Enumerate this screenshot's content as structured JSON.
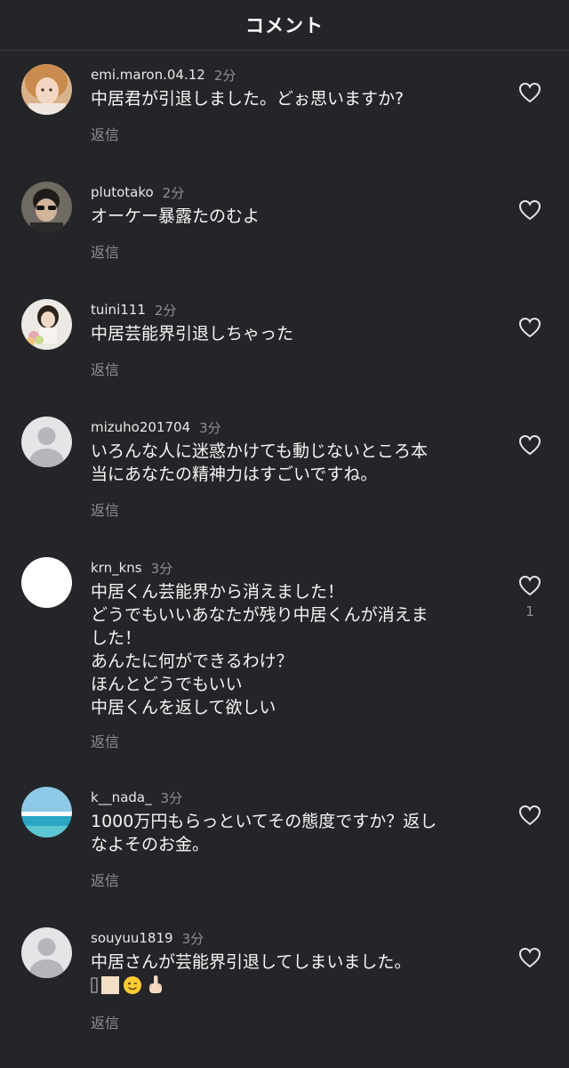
{
  "header": {
    "title": "コメント"
  },
  "comments": [
    {
      "username": "emi.maron.04.12",
      "time": "2分",
      "lines": [
        "中居君が引退しました。どぉ思いますか?"
      ],
      "reply_label": "返信"
    },
    {
      "username": "plutotako",
      "time": "2分",
      "lines": [
        "オーケー暴露たのむよ"
      ],
      "reply_label": "返信"
    },
    {
      "username": "tuini111",
      "time": "2分",
      "lines": [
        "中居芸能界引退しちゃった"
      ],
      "reply_label": "返信"
    },
    {
      "username": "mizuho201704",
      "time": "3分",
      "lines": [
        "いろんな人に迷惑かけても動じないところ本",
        "当にあなたの精神力はすごいですね。"
      ],
      "reply_label": "返信"
    },
    {
      "username": "krn_kns",
      "time": "3分",
      "lines": [
        "中居くん芸能界から消えました！",
        "どうでもいいあなたが残り中居くんが消えま",
        "した！",
        "あんたに何ができるわけ？",
        "ほんとどうでもいい",
        "中居くんを返して欲しい"
      ],
      "reply_label": "返信",
      "like_count": "1"
    },
    {
      "username": "k__nada_",
      "time": "3分",
      "lines": [
        "1000万円もらっといてその態度ですか？返し",
        "なよそのお金。"
      ],
      "reply_label": "返信"
    },
    {
      "username": "souyuu1819",
      "time": "3分",
      "lines": [
        "中居さんが芸能界引退してしまいました。"
      ],
      "emoji_names": [
        "broken-glyph-icon",
        "skin-tone-square-icon",
        "winking-face-icon",
        "middle-finger-icon"
      ],
      "reply_label": "返信"
    }
  ],
  "colors": {
    "background": "#242528",
    "text": "#f4f4f4",
    "muted": "#8e8f93"
  }
}
